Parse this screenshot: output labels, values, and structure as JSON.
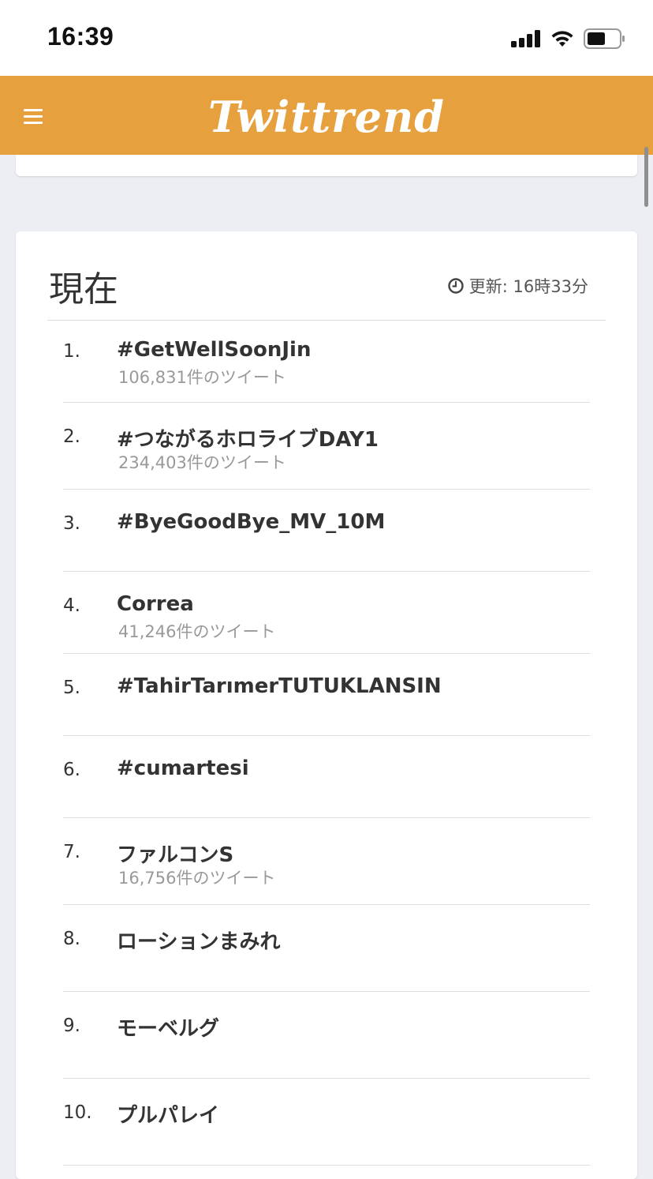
{
  "status_bar": {
    "time": "16:39",
    "icons": [
      "signal-icon",
      "wifi-icon",
      "battery-icon"
    ]
  },
  "header": {
    "menu_icon": "hamburger-menu-icon",
    "logo": "Twittrend",
    "color": "#e6a03e"
  },
  "section": {
    "title": "現在",
    "updated_icon": "clock-icon",
    "updated_text": "更新: 16時33分"
  },
  "trends": [
    {
      "rank": "1.",
      "name": "#GetWellSoonJin",
      "count": "106,831件のツイート"
    },
    {
      "rank": "2.",
      "name": "#つながるホロライブDAY1",
      "count": "234,403件のツイート"
    },
    {
      "rank": "3.",
      "name": "#ByeGoodBye_MV_10M",
      "count": ""
    },
    {
      "rank": "4.",
      "name": "Correa",
      "count": "41,246件のツイート"
    },
    {
      "rank": "5.",
      "name": "#TahirTarımerTUTUKLANSIN",
      "count": ""
    },
    {
      "rank": "6.",
      "name": "#cumartesi",
      "count": ""
    },
    {
      "rank": "7.",
      "name": "ファルコンS",
      "count": "16,756件のツイート"
    },
    {
      "rank": "8.",
      "name": "ローションまみれ",
      "count": ""
    },
    {
      "rank": "9.",
      "name": "モーベルグ",
      "count": ""
    },
    {
      "rank": "10.",
      "name": "プルパレイ",
      "count": ""
    }
  ]
}
